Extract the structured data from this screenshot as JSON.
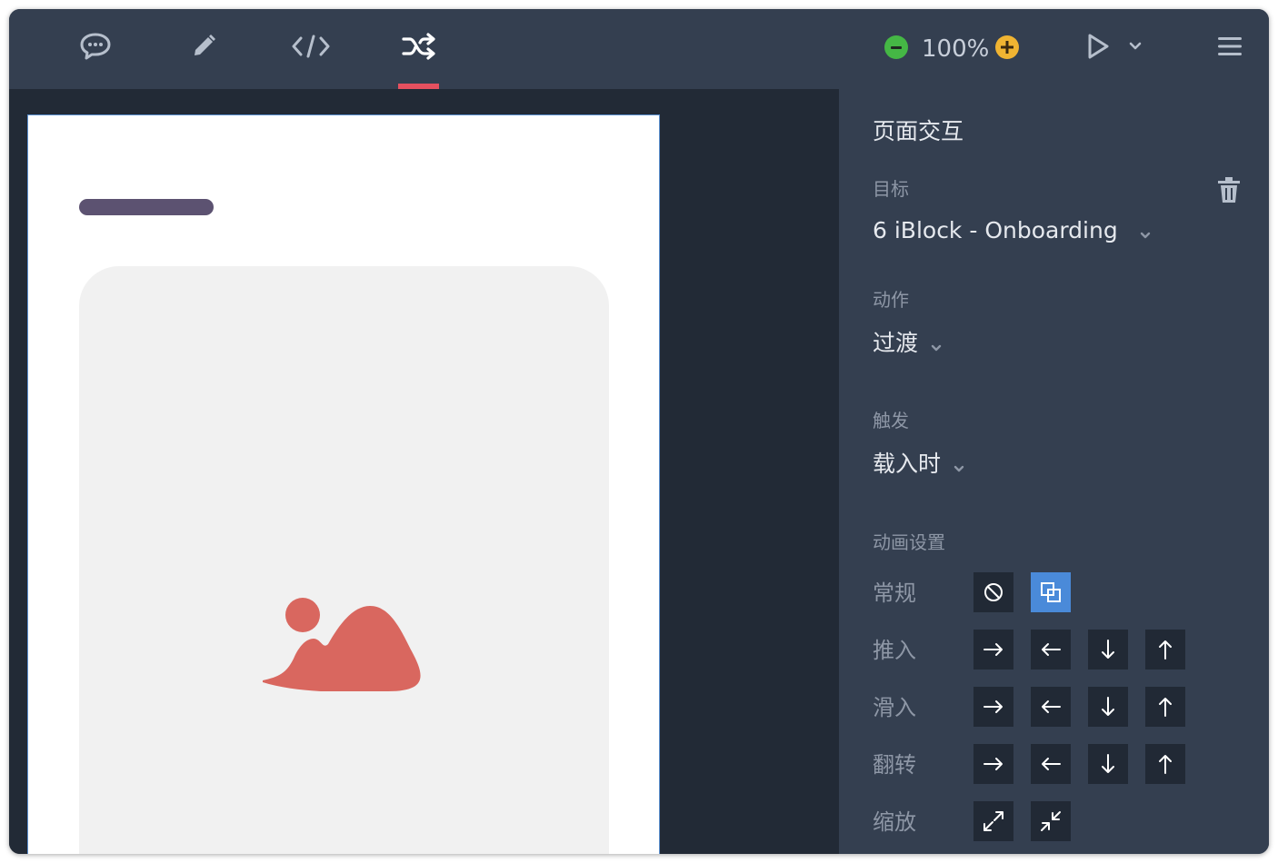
{
  "toolbar": {
    "tools": [
      {
        "name": "comment-icon"
      },
      {
        "name": "pencil-icon"
      },
      {
        "name": "code-icon"
      },
      {
        "name": "shuffle-icon",
        "active": true
      }
    ],
    "zoom": "100%",
    "accent": "#e5505f"
  },
  "panel": {
    "title": "页面交互",
    "target_label": "目标",
    "target_value": "6 iBlock - Onboarding",
    "action_label": "动作",
    "action_value": "过渡",
    "trigger_label": "触发",
    "trigger_value": "载入时",
    "anim_label": "动画设置",
    "rows": [
      {
        "label": "常规",
        "buttons": [
          "none-icon",
          "overlay-icon"
        ],
        "active": 1
      },
      {
        "label": "推入",
        "buttons": [
          "arrow-right-icon",
          "arrow-left-icon",
          "arrow-down-icon",
          "arrow-up-icon"
        ]
      },
      {
        "label": "滑入",
        "buttons": [
          "arrow-right-icon",
          "arrow-left-icon",
          "arrow-down-icon",
          "arrow-up-icon"
        ]
      },
      {
        "label": "翻转",
        "buttons": [
          "arrow-right-icon",
          "arrow-left-icon",
          "arrow-down-icon",
          "arrow-up-icon"
        ]
      },
      {
        "label": "缩放",
        "buttons": [
          "expand-icon",
          "collapse-icon"
        ]
      }
    ]
  },
  "colors": {
    "topbar": "#343f50",
    "canvas": "#222a36",
    "active_button": "#4a8ad9",
    "image_placeholder": "#d9675f",
    "title_placeholder": "#5c5271"
  }
}
